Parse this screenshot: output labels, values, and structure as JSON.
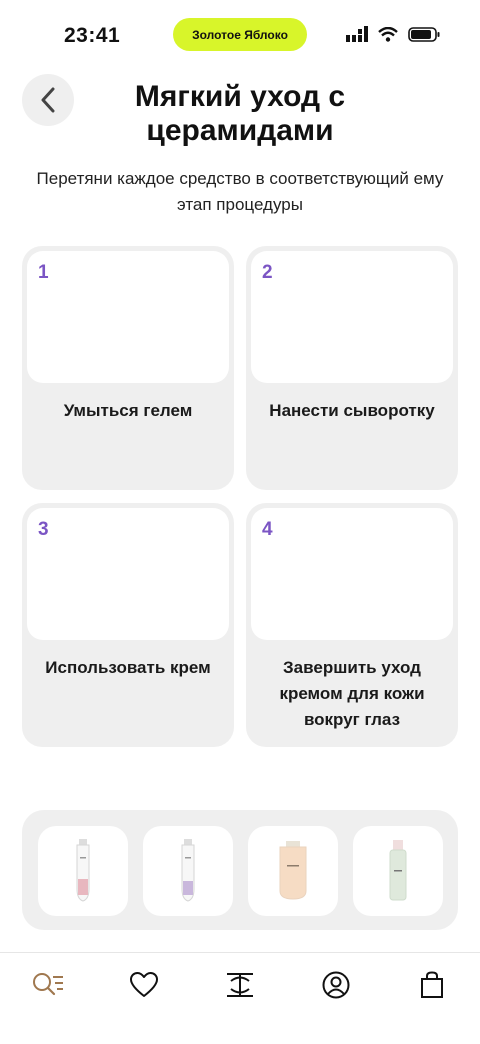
{
  "status_bar": {
    "time": "23:41",
    "promo_pill": "Золотое Яблоко"
  },
  "header": {
    "title": "Мягкий уход с церамидами"
  },
  "instructions": "Перетяни каждое средство в соответствующий ему этап процедуры",
  "steps": [
    {
      "number": "1",
      "label": "Умыться гелем"
    },
    {
      "number": "2",
      "label": "Нанести сыворотку"
    },
    {
      "number": "3",
      "label": "Использовать крем"
    },
    {
      "number": "4",
      "label": "Завершить уход кремом для кожи вокруг глаз"
    }
  ],
  "products": [
    {
      "icon": "tube-pink-icon",
      "accent": "#e8b7bf"
    },
    {
      "icon": "tube-lilac-icon",
      "accent": "#c9b7dc"
    },
    {
      "icon": "tube-peach-icon",
      "accent": "#f6dcc4"
    },
    {
      "icon": "bottle-green-icon",
      "accent": "#dfe9dc"
    }
  ],
  "tab_bar": [
    "search-menu-icon",
    "heart-icon",
    "brand-logo-icon",
    "profile-icon",
    "bag-icon"
  ],
  "colors": {
    "accent": "#7b55c4",
    "promo": "#d8f52a",
    "card": "#efefef"
  }
}
